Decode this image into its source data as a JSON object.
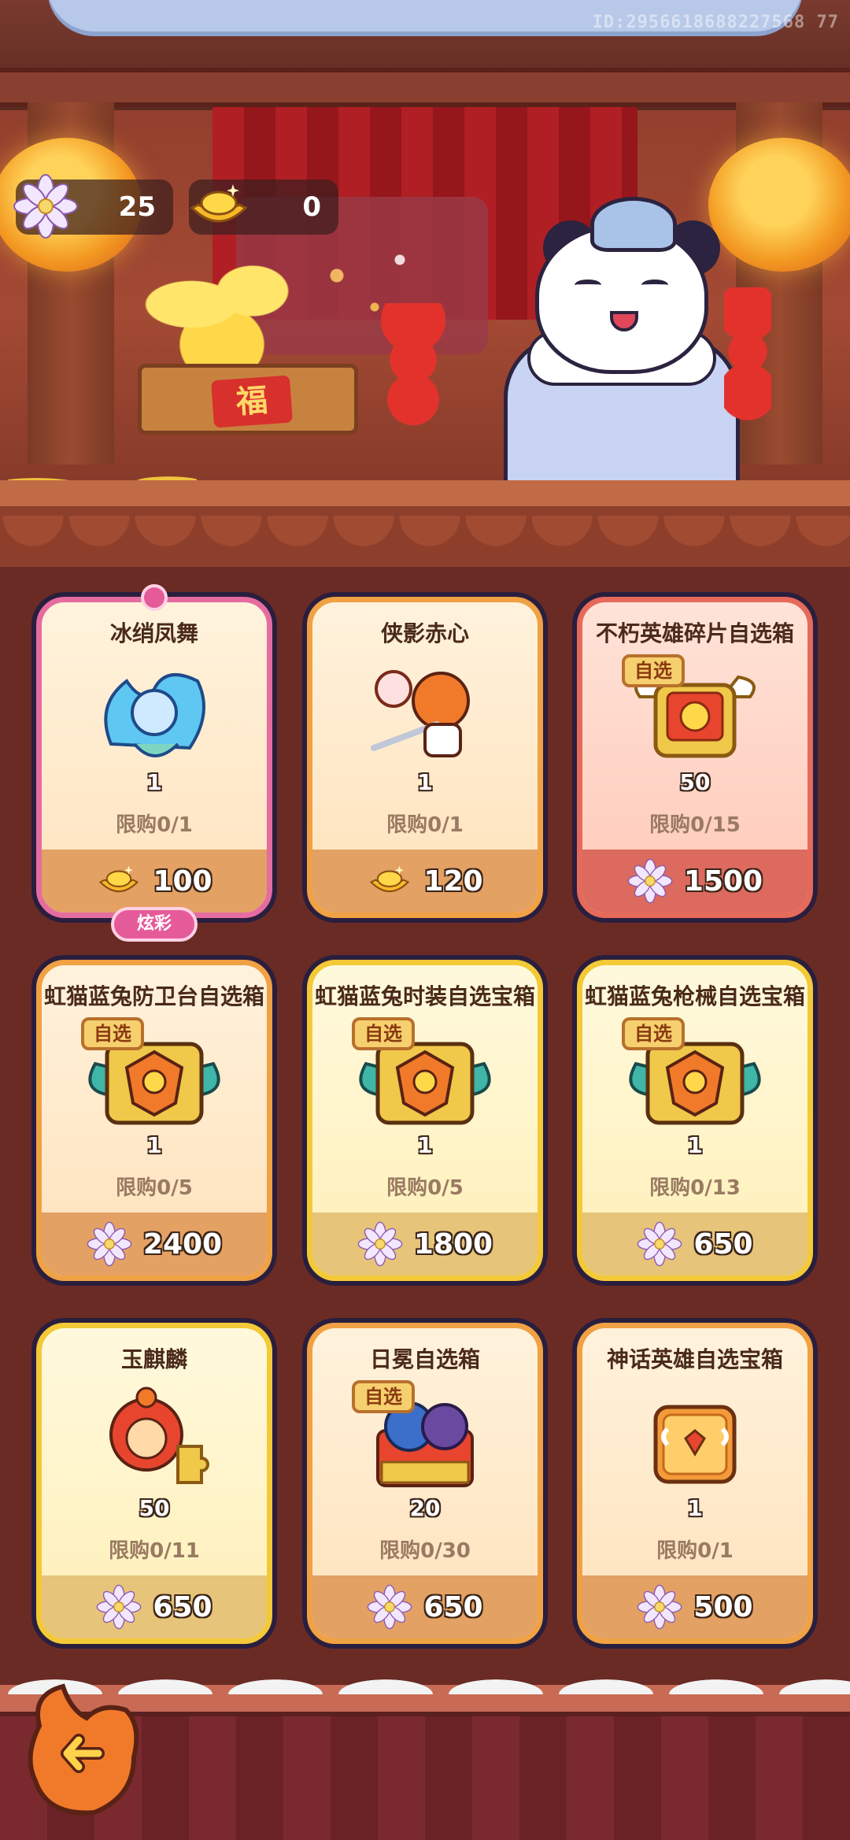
{
  "header": {
    "user_id": "ID:2956618688227568 77",
    "fu_char": "福"
  },
  "currency": {
    "lotus": {
      "icon": "lotus-icon",
      "value": "25"
    },
    "gold": {
      "icon": "gold-ingot-icon",
      "value": "0"
    }
  },
  "items": [
    {
      "title": "冰绡凤舞",
      "qty": "1",
      "limit": "限购0/1",
      "price": "100",
      "currency": "gold-ingot-icon",
      "art": "hero-skin-ice-phoenix",
      "style": "special",
      "tag": "",
      "badge": "炫彩"
    },
    {
      "title": "侠影赤心",
      "qty": "1",
      "limit": "限购0/1",
      "price": "120",
      "currency": "gold-ingot-icon",
      "art": "hero-skin-fox-swordsman",
      "style": "orange",
      "tag": ""
    },
    {
      "title": "不朽英雄碎片自选箱",
      "qty": "50",
      "limit": "限购0/15",
      "price": "1500",
      "currency": "lotus-icon",
      "art": "winged-gold-chest",
      "style": "red",
      "tag": "自选"
    },
    {
      "title": "虹猫蓝兔防卫台自选箱",
      "qty": "1",
      "limit": "限购0/5",
      "price": "2400",
      "currency": "lotus-icon",
      "art": "fox-emblem-chest",
      "style": "orange",
      "tag": "自选"
    },
    {
      "title": "虹猫蓝兔时装自选宝箱",
      "qty": "1",
      "limit": "限购0/5",
      "price": "1800",
      "currency": "lotus-icon",
      "art": "fox-emblem-chest",
      "style": "yellow",
      "tag": "自选"
    },
    {
      "title": "虹猫蓝兔枪械自选宝箱",
      "qty": "1",
      "limit": "限购0/13",
      "price": "650",
      "currency": "lotus-icon",
      "art": "fox-emblem-chest",
      "style": "yellow",
      "tag": "自选"
    },
    {
      "title": "玉麒麟",
      "qty": "50",
      "limit": "限购0/11",
      "price": "650",
      "currency": "lotus-icon",
      "art": "qilin-puzzle-piece",
      "style": "yellow",
      "tag": ""
    },
    {
      "title": "日冕自选箱",
      "qty": "20",
      "limit": "限购0/30",
      "price": "650",
      "currency": "lotus-icon",
      "art": "corona-hero-chest",
      "style": "orange",
      "tag": "自选"
    },
    {
      "title": "神话英雄自选宝箱",
      "qty": "1",
      "limit": "限购0/1",
      "price": "500",
      "currency": "lotus-icon",
      "art": "mythic-winged-chest",
      "style": "orange",
      "tag": ""
    }
  ],
  "nav": {
    "back": "back-arrow-icon"
  },
  "colors": {
    "background": "#6a2b25",
    "price_text": "#ffffff",
    "limit_text": "#9a7a62"
  }
}
